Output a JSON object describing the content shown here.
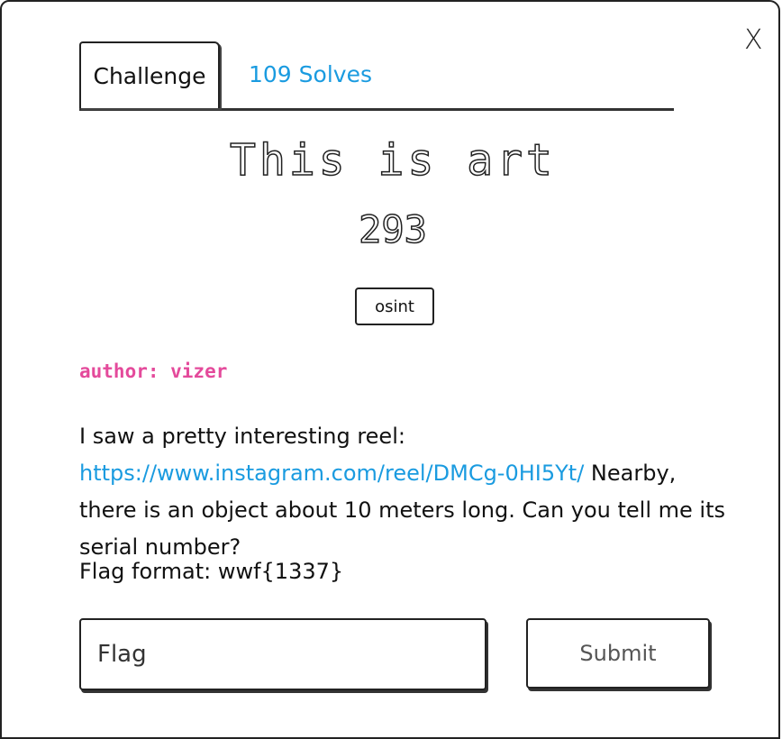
{
  "close_label": "X",
  "tabs": {
    "challenge_label": "Challenge",
    "solves_label": "109 Solves"
  },
  "challenge": {
    "title": "This is art",
    "value": "293",
    "tag": "osint",
    "author": "author: vizer",
    "description": {
      "intro": "I saw a pretty interesting reel: ",
      "link": "https://www.instagram.com/reel/DMCg-0HI5Yt/",
      "rest": " Nearby, there is an object about 10 meters long. Can you tell me its serial number?"
    },
    "flag_format": "Flag format: wwf{1337}"
  },
  "form": {
    "flag_placeholder": "Flag",
    "submit_label": "Submit"
  },
  "colors": {
    "link": "#1a9be0",
    "author": "#e44a9b"
  }
}
